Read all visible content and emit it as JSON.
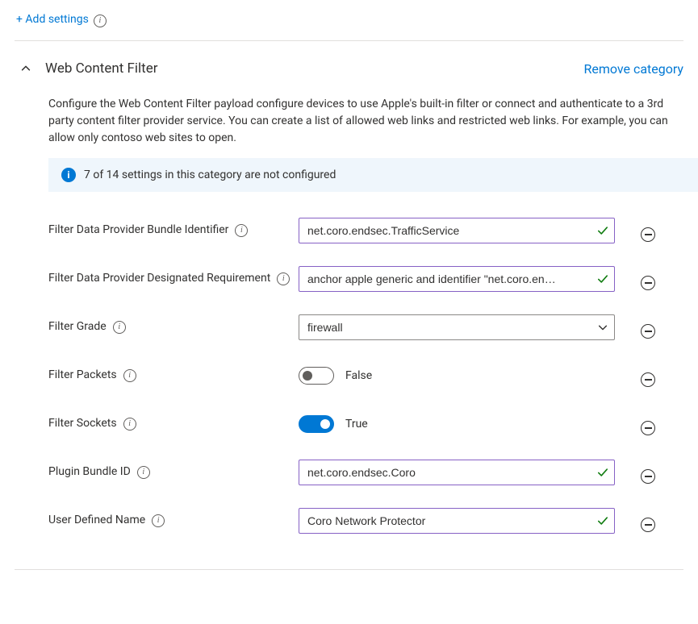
{
  "add_settings_link": "+ Add settings",
  "category": {
    "title": "Web Content Filter",
    "remove_link": "Remove category",
    "description": "Configure the Web Content Filter payload configure devices to use Apple's built-in filter or connect and authenticate to a 3rd party content filter provider service. You can create a list of allowed web links and restricted web links. For example, you can allow only contoso web sites to open.",
    "banner_text": "7 of 14 settings in this category are not configured",
    "settings": [
      {
        "label": "Filter Data Provider Bundle Identifier",
        "type": "text",
        "value": "net.coro.endsec.TrafficService"
      },
      {
        "label": "Filter Data Provider Designated Requirement",
        "type": "text",
        "value": "anchor apple generic and identifier \"net.coro.en…"
      },
      {
        "label": "Filter Grade",
        "type": "select",
        "value": "firewall"
      },
      {
        "label": "Filter Packets",
        "type": "toggle",
        "value": false,
        "text": "False"
      },
      {
        "label": "Filter Sockets",
        "type": "toggle",
        "value": true,
        "text": "True"
      },
      {
        "label": "Plugin Bundle ID",
        "type": "text",
        "value": "net.coro.endsec.Coro"
      },
      {
        "label": "User Defined Name",
        "type": "text",
        "value": "Coro Network Protector"
      }
    ]
  }
}
